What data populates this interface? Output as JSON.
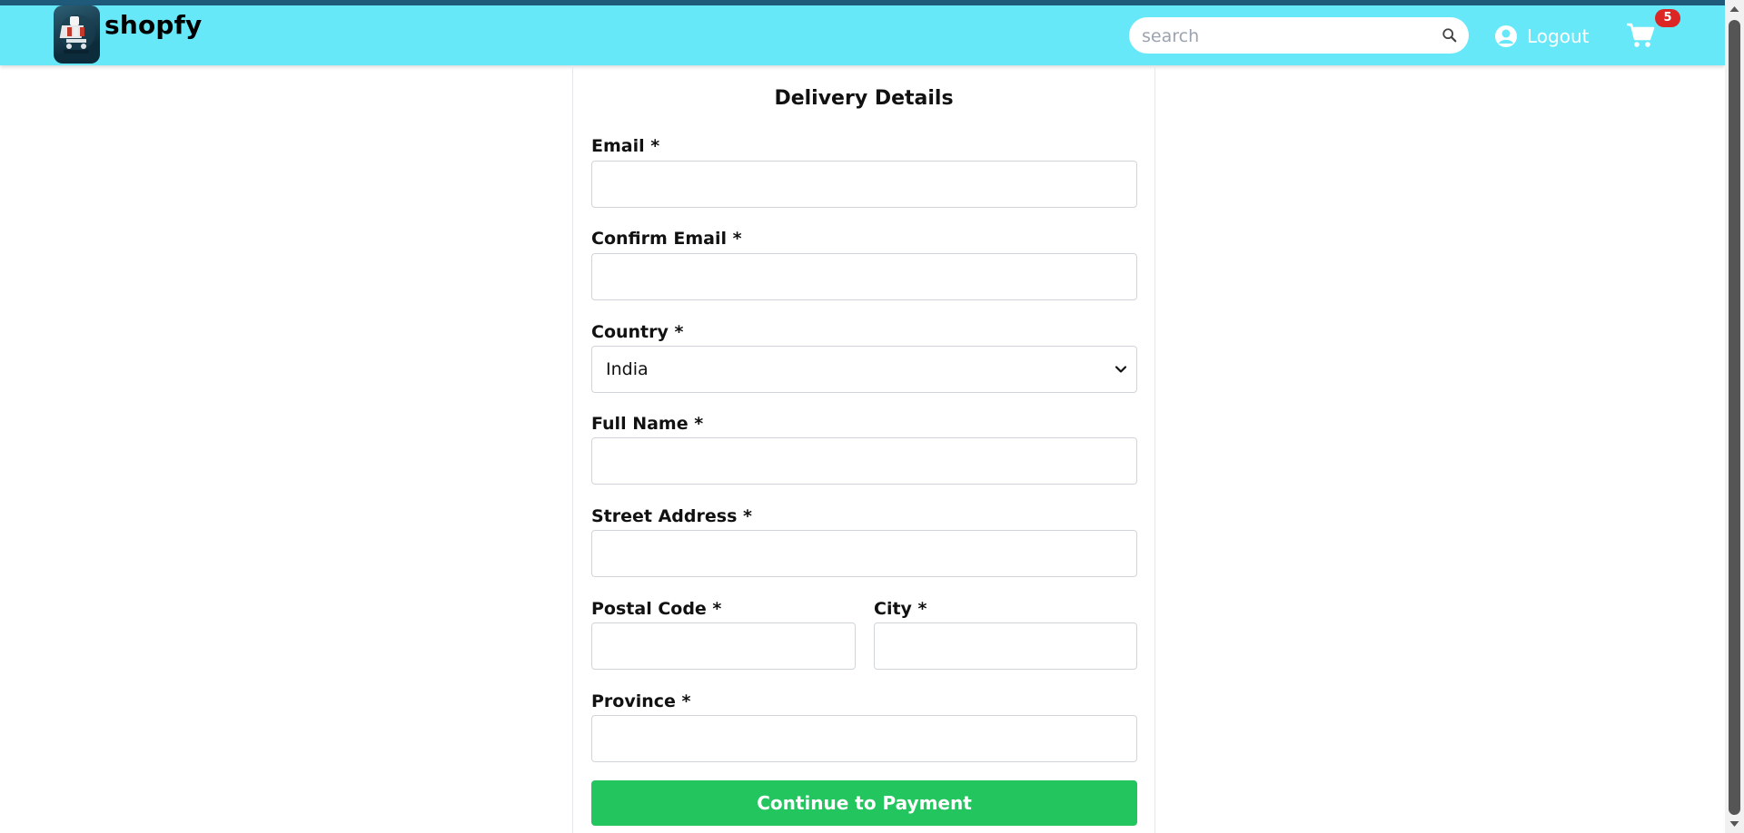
{
  "header": {
    "brand": "shopfy",
    "search_placeholder": "search",
    "logout_label": "Logout",
    "cart_count": "5",
    "colors": {
      "navbar": "#67e8f9",
      "badge": "#dc2626"
    }
  },
  "form": {
    "title": "Delivery Details",
    "fields": {
      "email": {
        "label": "Email *",
        "value": ""
      },
      "confirm_email": {
        "label": "Confirm Email *",
        "value": ""
      },
      "country": {
        "label": "Country *",
        "value": "India"
      },
      "full_name": {
        "label": "Full Name *",
        "value": ""
      },
      "street": {
        "label": "Street Address *",
        "value": ""
      },
      "postal": {
        "label": "Postal Code *",
        "value": ""
      },
      "city": {
        "label": "City *",
        "value": ""
      },
      "province": {
        "label": "Province *",
        "value": ""
      }
    },
    "submit_label": "Continue to Payment",
    "colors": {
      "submit": "#22c55e"
    }
  },
  "icons": {
    "logo": "shopping-cart-logo-icon",
    "search": "search-icon",
    "user": "user-circle-icon",
    "cart": "cart-icon",
    "select": "chevron-down-icon"
  }
}
